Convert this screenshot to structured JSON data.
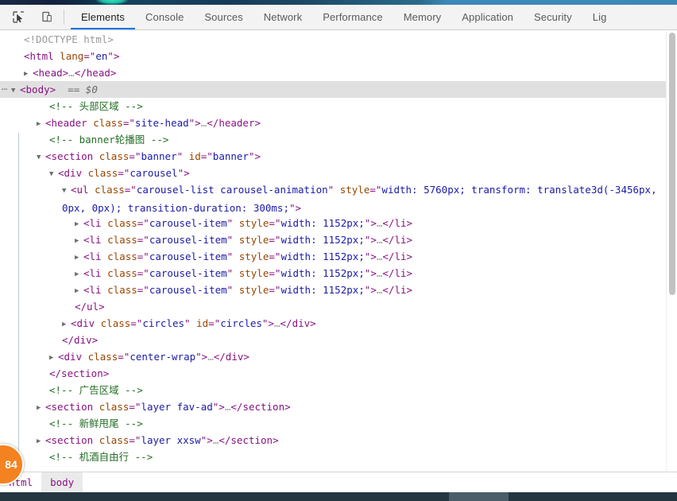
{
  "toolbar": {
    "icons": [
      {
        "name": "inspect-element-icon",
        "title": "Select an element in the page to inspect it"
      },
      {
        "name": "device-toolbar-icon",
        "title": "Toggle device toolbar"
      }
    ],
    "tabs": [
      {
        "label": "Elements",
        "active": true
      },
      {
        "label": "Console",
        "active": false
      },
      {
        "label": "Sources",
        "active": false
      },
      {
        "label": "Network",
        "active": false
      },
      {
        "label": "Performance",
        "active": false
      },
      {
        "label": "Memory",
        "active": false
      },
      {
        "label": "Application",
        "active": false
      },
      {
        "label": "Security",
        "active": false
      },
      {
        "label": "Lig",
        "active": false
      }
    ],
    "accent_color": "#1a73e8"
  },
  "dom_tree": {
    "rows": [
      {
        "id": "doctype",
        "text": "<!DOCTYPE html>"
      },
      {
        "id": "html-open",
        "tag": "html",
        "attr_name": "lang",
        "attr_value": "en"
      },
      {
        "id": "head",
        "tag": "head"
      },
      {
        "id": "body",
        "tag": "body",
        "suffix": "== $0",
        "selected": true
      },
      {
        "id": "comment-head",
        "text": "<!-- 头部区域 -->"
      },
      {
        "id": "header",
        "tag": "header",
        "attr_name": "class",
        "attr_value": "site-head"
      },
      {
        "id": "comment-banner",
        "text": "<!-- banner轮播图 -->"
      },
      {
        "id": "section-banner",
        "tag": "section",
        "attr_name": "class",
        "attr_value": "banner",
        "attr2_name": "id",
        "attr2_value": "banner"
      },
      {
        "id": "div-carousel",
        "tag": "div",
        "attr_name": "class",
        "attr_value": "carousel"
      },
      {
        "id": "ul-carousel-list",
        "tag": "ul",
        "attr_name": "class",
        "attr_value": "carousel-list carousel-animation",
        "attr2_name": "style",
        "attr2_value_part1": "width: 5760px; transform: translate3d(-34",
        "attr2_value_part2": "56px, 0px, 0px); transition-duration: 300ms;"
      },
      {
        "id": "li-1",
        "tag": "li",
        "attr_name": "class",
        "attr_value": "carousel-item",
        "attr2_name": "style",
        "attr2_value": "width: 1152px;"
      },
      {
        "id": "li-2",
        "tag": "li",
        "attr_name": "class",
        "attr_value": "carousel-item",
        "attr2_name": "style",
        "attr2_value": "width: 1152px;"
      },
      {
        "id": "li-3",
        "tag": "li",
        "attr_name": "class",
        "attr_value": "carousel-item",
        "attr2_name": "style",
        "attr2_value": "width: 1152px;"
      },
      {
        "id": "li-4",
        "tag": "li",
        "attr_name": "class",
        "attr_value": "carousel-item",
        "attr2_name": "style",
        "attr2_value": "width: 1152px;"
      },
      {
        "id": "li-5",
        "tag": "li",
        "attr_name": "class",
        "attr_value": "carousel-item",
        "attr2_name": "style",
        "attr2_value": "width: 1152px;"
      },
      {
        "id": "ul-close",
        "text": "</ul>"
      },
      {
        "id": "div-circles",
        "tag": "div",
        "attr_name": "class",
        "attr_value": "circles",
        "attr2_name": "id",
        "attr2_value": "circles"
      },
      {
        "id": "div-close-1",
        "text": "</div>"
      },
      {
        "id": "div-center-wrap",
        "tag": "div",
        "attr_name": "class",
        "attr_value": "center-wrap"
      },
      {
        "id": "section-close",
        "text": "</section>"
      },
      {
        "id": "comment-ad",
        "text": "<!-- 广告区域 -->"
      },
      {
        "id": "section-fav-ad",
        "tag": "section",
        "attr_name": "class",
        "attr_value": "layer fav-ad"
      },
      {
        "id": "comment-xxsw",
        "text": "<!-- 新鲜甩尾 -->"
      },
      {
        "id": "section-xxsw",
        "tag": "section",
        "attr_name": "class",
        "attr_value": "layer xxsw"
      },
      {
        "id": "comment-jjzyx",
        "text": "<!-- 机酒自由行 -->"
      }
    ],
    "ellipsis": "…",
    "colors": {
      "tag": "#881280",
      "attr_name": "#994500",
      "attr_value": "#1a1aa6",
      "comment": "#236e25",
      "selected_row_bg": "#e0e0e0"
    }
  },
  "issue_badge": {
    "count": "84"
  },
  "breadcrumb": {
    "items": [
      {
        "label": "html",
        "active": false
      },
      {
        "label": "body",
        "active": true
      }
    ]
  }
}
